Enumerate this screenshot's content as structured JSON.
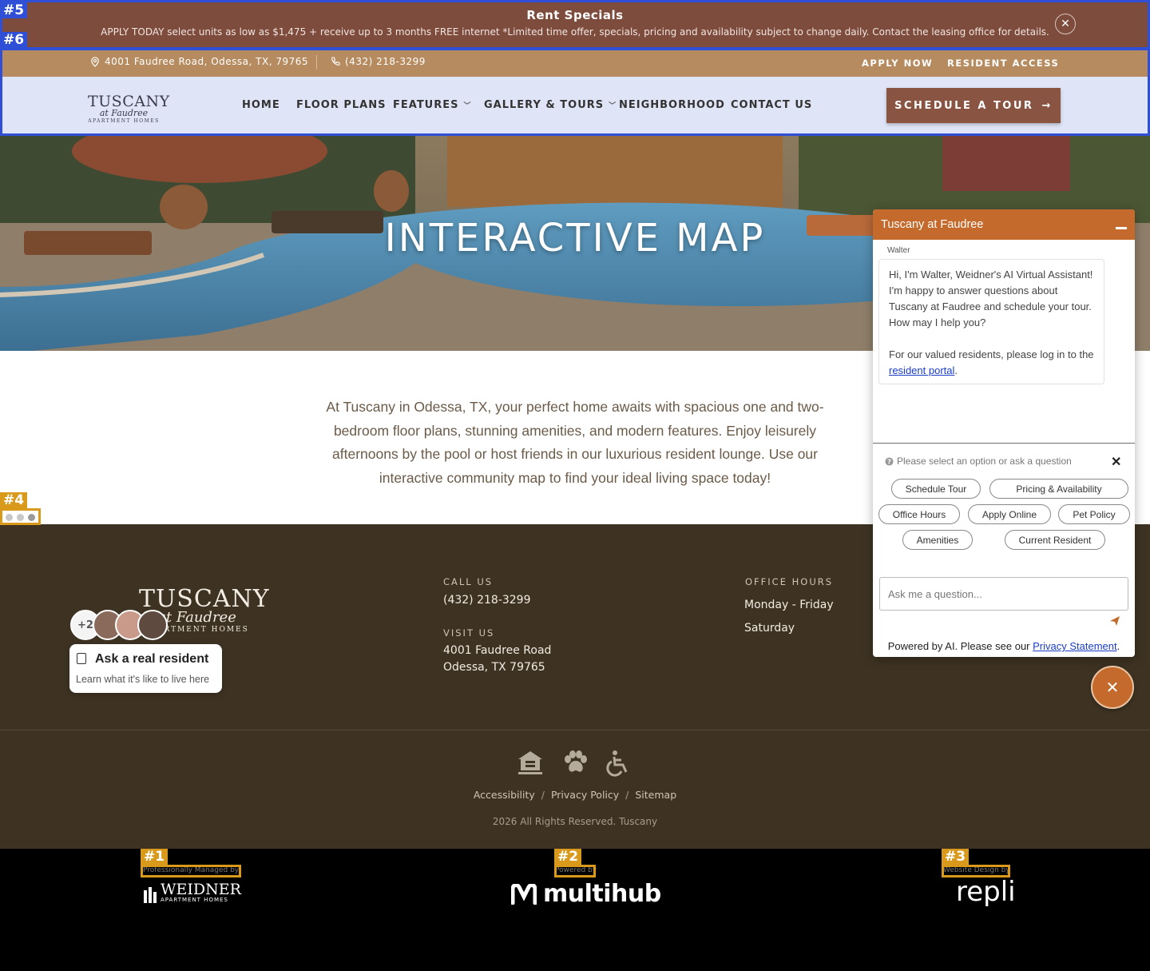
{
  "banner": {
    "title": "Rent Specials",
    "text": "APPLY TODAY select units as low as $1,475 + receive up to 3 months FREE internet *Limited time offer, specials, pricing and availability subject to change daily. Contact the leasing office for details.",
    "close_label": "✕"
  },
  "topbar": {
    "address": "4001 Faudree Road, Odessa, TX, 79765",
    "phone": "(432) 218-3299",
    "apply_label": "APPLY NOW",
    "resident_label": "RESIDENT ACCESS"
  },
  "logo": {
    "line1": "TUSCANY",
    "line2": "at Faudree",
    "line3": "APARTMENT HOMES"
  },
  "nav": {
    "items": [
      {
        "label": "HOME"
      },
      {
        "label": "FLOOR PLANS"
      },
      {
        "label": "FEATURES"
      },
      {
        "label": "GALLERY & TOURS"
      },
      {
        "label": "NEIGHBORHOOD"
      },
      {
        "label": "CONTACT US"
      }
    ],
    "cta_label": "SCHEDULE A TOUR"
  },
  "hero": {
    "title": "INTERACTIVE MAP"
  },
  "intro": {
    "text": "At Tuscany in Odessa, TX, your perfect home awaits with spacious one and two-bedroom floor plans, stunning amenities, and modern features. Enjoy leisurely afternoons by the pool or host friends in our luxurious resident lounge. Use our interactive community map to find your ideal living space today!"
  },
  "footer": {
    "call_heading": "CALL US",
    "phone": "(432) 218-3299",
    "visit_heading": "VISIT US",
    "address_line1": "4001 Faudree Road",
    "address_line2": "Odessa, TX 79765",
    "hours_heading": "OFFICE HOURS",
    "hours_row1": "Monday - Friday",
    "hours_row2": "Saturday",
    "links": [
      "Accessibility",
      "Privacy Policy",
      "Sitemap"
    ],
    "copyright": "2026 All Rights Reserved. Tuscany"
  },
  "credits": {
    "managed_label": "Professionally Managed by",
    "managed_name": "WEIDNER",
    "managed_sub": "APARTMENT HOMES",
    "powered_label": "Powered by",
    "powered_name": "multihub",
    "design_label": "Website Design by",
    "design_name": "repli"
  },
  "resident_widget": {
    "extra_count": "+2",
    "title": "Ask a real resident",
    "subtitle": "Learn what it's like to live here"
  },
  "chat": {
    "title": "Tuscany at Faudree",
    "agent": "Walter",
    "message1": "Hi, I'm Walter, Weidner's AI Virtual Assistant! I'm happy to answer questions about Tuscany at Faudree and schedule your tour. How may I help you?",
    "message2_prefix": "For our valued residents, please log in to the ",
    "message2_link": "resident portal",
    "message2_suffix": ".",
    "prompt": "Please select an option or ask a question",
    "options": [
      "Schedule Tour",
      "Pricing & Availability",
      "Office Hours",
      "Apply Online",
      "Pet Policy",
      "Amenities",
      "Current Resident"
    ],
    "input_placeholder": "Ask me a question...",
    "powered_prefix": "Powered by AI. Please see our ",
    "powered_link": "Privacy Statement",
    "powered_suffix": "."
  },
  "annotations": [
    "#1",
    "#2",
    "#3",
    "#4",
    "#5",
    "#6"
  ],
  "colors": {
    "banner": "#7e4c3d",
    "topbar": "#b58b5f",
    "nav_bg": "#dfe5f6",
    "cta": "#8a5443",
    "footer": "#3e3323",
    "chat_accent": "#c36a2c"
  }
}
